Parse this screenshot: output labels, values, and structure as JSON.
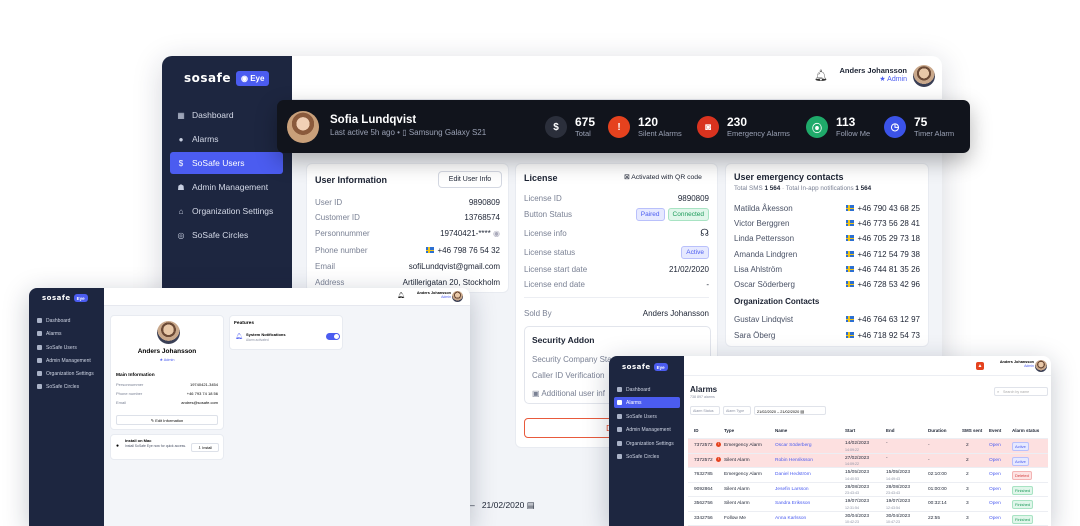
{
  "main": {
    "logo": "sosafe",
    "eye_badge": "Eye",
    "user": {
      "name": "Anders Johansson",
      "role": "Admin"
    },
    "nav": [
      {
        "label": "Dashboard",
        "icon": "grid-icon"
      },
      {
        "label": "Alarms",
        "icon": "alert-icon"
      },
      {
        "label": "SoSafe Users",
        "icon": "dollar-icon"
      },
      {
        "label": "Admin Management",
        "icon": "people-icon"
      },
      {
        "label": "Organization Settings",
        "icon": "building-icon"
      },
      {
        "label": "SoSafe Circles",
        "icon": "circles-icon"
      }
    ],
    "banner": {
      "name": "Sofia Lundqvist",
      "last_active": "Last active 5h ago",
      "device": "Samsung Galaxy S21",
      "stats": [
        {
          "value": "675",
          "label": "Total",
          "icon": "dollar-icon",
          "color": "#2b2f3b"
        },
        {
          "value": "120",
          "label": "Silent Alarms",
          "icon": "exclaim-icon",
          "color": "#e5421e"
        },
        {
          "value": "230",
          "label": "Emergency Alarms",
          "icon": "siren-icon",
          "color": "#d9331f"
        },
        {
          "value": "113",
          "label": "Follow Me",
          "icon": "signal-icon",
          "color": "#1faa6a"
        },
        {
          "value": "75",
          "label": "Timer Alarm",
          "icon": "timer-icon",
          "color": "#3b53e8"
        }
      ]
    },
    "user_info": {
      "title": "User Information",
      "edit_label": "Edit User Info",
      "rows": [
        {
          "k": "User ID",
          "v": "9890809"
        },
        {
          "k": "Customer ID",
          "v": "13768574"
        },
        {
          "k": "Personnummer",
          "v": "19740421-****"
        },
        {
          "k": "Phone number",
          "v": "+46 798 76 54 32"
        },
        {
          "k": "Email",
          "v": "sofiLundqvist@gmail.com"
        },
        {
          "k": "Address",
          "v": "Artillerigatan 20, Stockholm"
        }
      ]
    },
    "license": {
      "title": "License",
      "qr_label": "Activated with QR code",
      "rows": [
        {
          "k": "License ID",
          "v": "9890809"
        },
        {
          "k": "Button Status",
          "v": ""
        },
        {
          "k": "License info",
          "v": ""
        },
        {
          "k": "License status",
          "v": ""
        },
        {
          "k": "License start date",
          "v": "21/02/2020"
        },
        {
          "k": "License end date",
          "v": "-"
        }
      ],
      "paired": "Paired",
      "connected": "Connected",
      "active": "Active",
      "sold_by_label": "Sold By",
      "sold_by": "Anders Johansson",
      "addon_title": "Security Addon",
      "addon_rows": [
        "Security Company Sta",
        "Caller ID Verification",
        "Additional user inf"
      ],
      "deactivate": "Deacti"
    },
    "contacts": {
      "title": "User emergency contacts",
      "summary_prefix": "Total SMS ",
      "summary_sms": "1 564",
      "summary_mid": " · Total In-app notifications ",
      "summary_inapp": "1 564",
      "rows": [
        {
          "k": "Matilda Åkesson",
          "v": "+46 790 43 68 25"
        },
        {
          "k": "Victor Berggren",
          "v": "+46 773 56 28 41"
        },
        {
          "k": "Linda Pettersson",
          "v": "+46 705 29 73 18"
        },
        {
          "k": "Amanda Lindgren",
          "v": "+46 712 54 79 38"
        },
        {
          "k": "Lisa Ahlström",
          "v": "+46 744 81 35 26"
        },
        {
          "k": "Oscar Söderberg",
          "v": "+46 728 53 42 96"
        }
      ],
      "org_title": "Organization Contacts",
      "org_rows": [
        {
          "k": "Gustav Lindqvist",
          "v": "+46 764 63 12 97"
        },
        {
          "k": "Sara Öberg",
          "v": "+46 718 92 54 73"
        }
      ]
    }
  },
  "left": {
    "logo": "sosafe",
    "eye_badge": "Eye",
    "nav": [
      "Dashboard",
      "Alarms",
      "SoSafe Users",
      "Admin Management",
      "Organization Settings",
      "SoSafe Circles"
    ],
    "top_user": "Anders Johansson",
    "top_role": "Admin",
    "profile_name": "Anders Johansson",
    "profile_role": "Admin",
    "info_title": "Main Information",
    "info_rows": [
      {
        "k": "Personnummer",
        "v": "19740421-3454"
      },
      {
        "k": "Phone number",
        "v": "+46 793 74 18 56"
      },
      {
        "k": "Email",
        "v": "andres@sosafe.com"
      }
    ],
    "edit_label": "Edit Information",
    "features_title": "Features",
    "feature_name": "System Notifications",
    "feature_sub": "Alarm activated",
    "install_title": "Install on Mac",
    "install_text": "Install SoSafe Eye now for quick access.",
    "install_btn": "Install",
    "date": "21/02/2020"
  },
  "right": {
    "logo": "sosafe",
    "eye_badge": "Eye",
    "nav": [
      "Dashboard",
      "Alarms",
      "SoSafe Users",
      "Admin Management",
      "Organization Settings",
      "SoSafe Circles"
    ],
    "top_user": "Anders Johansson",
    "top_role": "Admin",
    "title": "Alarms",
    "subtitle": "738 897 alarms",
    "search_placeholder": "Search by name",
    "filters": [
      "Alarm Status",
      "Alarm Type",
      "21/02/2020",
      "21/02/2020"
    ],
    "headers": [
      "ID",
      "Type",
      "Name",
      "Start",
      "End",
      "Duration",
      "SMS sent",
      "Event",
      "Alarm status"
    ],
    "rows": [
      {
        "id": "7372572",
        "type": "Emergency Alarm",
        "name": "Oscar Söderberg",
        "start": "14/02/2023",
        "start_t": "14:09:22",
        "end": "-",
        "dur": "-",
        "sms": "2",
        "event": "Open",
        "status": "Active",
        "red": true,
        "alert": true
      },
      {
        "id": "7372572",
        "type": "Silent Alarm",
        "name": "Robin Henriksson",
        "start": "27/02/2023",
        "start_t": "14:09:22",
        "end": "-",
        "dur": "-",
        "sms": "2",
        "event": "Open",
        "status": "Active",
        "red": true,
        "alert": true
      },
      {
        "id": "7632785",
        "type": "Emergency Alarm",
        "name": "Daniel Hedström",
        "start": "15/05/2023",
        "start_t": "14:40:53",
        "end": "15/05/2023",
        "end_t": "14:49:43",
        "dur": "02:10:00",
        "sms": "2",
        "event": "Open",
        "status": "Deleted",
        "red": false
      },
      {
        "id": "9092864",
        "type": "Silent Alarm",
        "name": "Jesefin Larsson",
        "start": "28/08/2023",
        "start_t": "23:43:43",
        "end": "28/08/2023",
        "end_t": "23:43:43",
        "dur": "01:00:00",
        "sms": "3",
        "event": "Open",
        "status": "Finished",
        "red": false
      },
      {
        "id": "3562756",
        "type": "Silent Alarm",
        "name": "Sandra Eriksson",
        "start": "19/07/2023",
        "start_t": "12:31:54",
        "end": "19/07/2023",
        "end_t": "12:43:54",
        "dur": "00:32:14",
        "sms": "3",
        "event": "Open",
        "status": "Finished",
        "red": false
      },
      {
        "id": "3342756",
        "type": "Follow Me",
        "name": "Anna Karlsson",
        "start": "30/04/2023",
        "start_t": "10:42:23",
        "end": "30/04/2023",
        "end_t": "10:47:23",
        "dur": "22:55",
        "sms": "3",
        "event": "Open",
        "status": "Finished",
        "red": false
      }
    ]
  },
  "colors": {
    "sidebar": "#1d2640",
    "accent": "#4b5cf0",
    "banner": "#11141c"
  }
}
